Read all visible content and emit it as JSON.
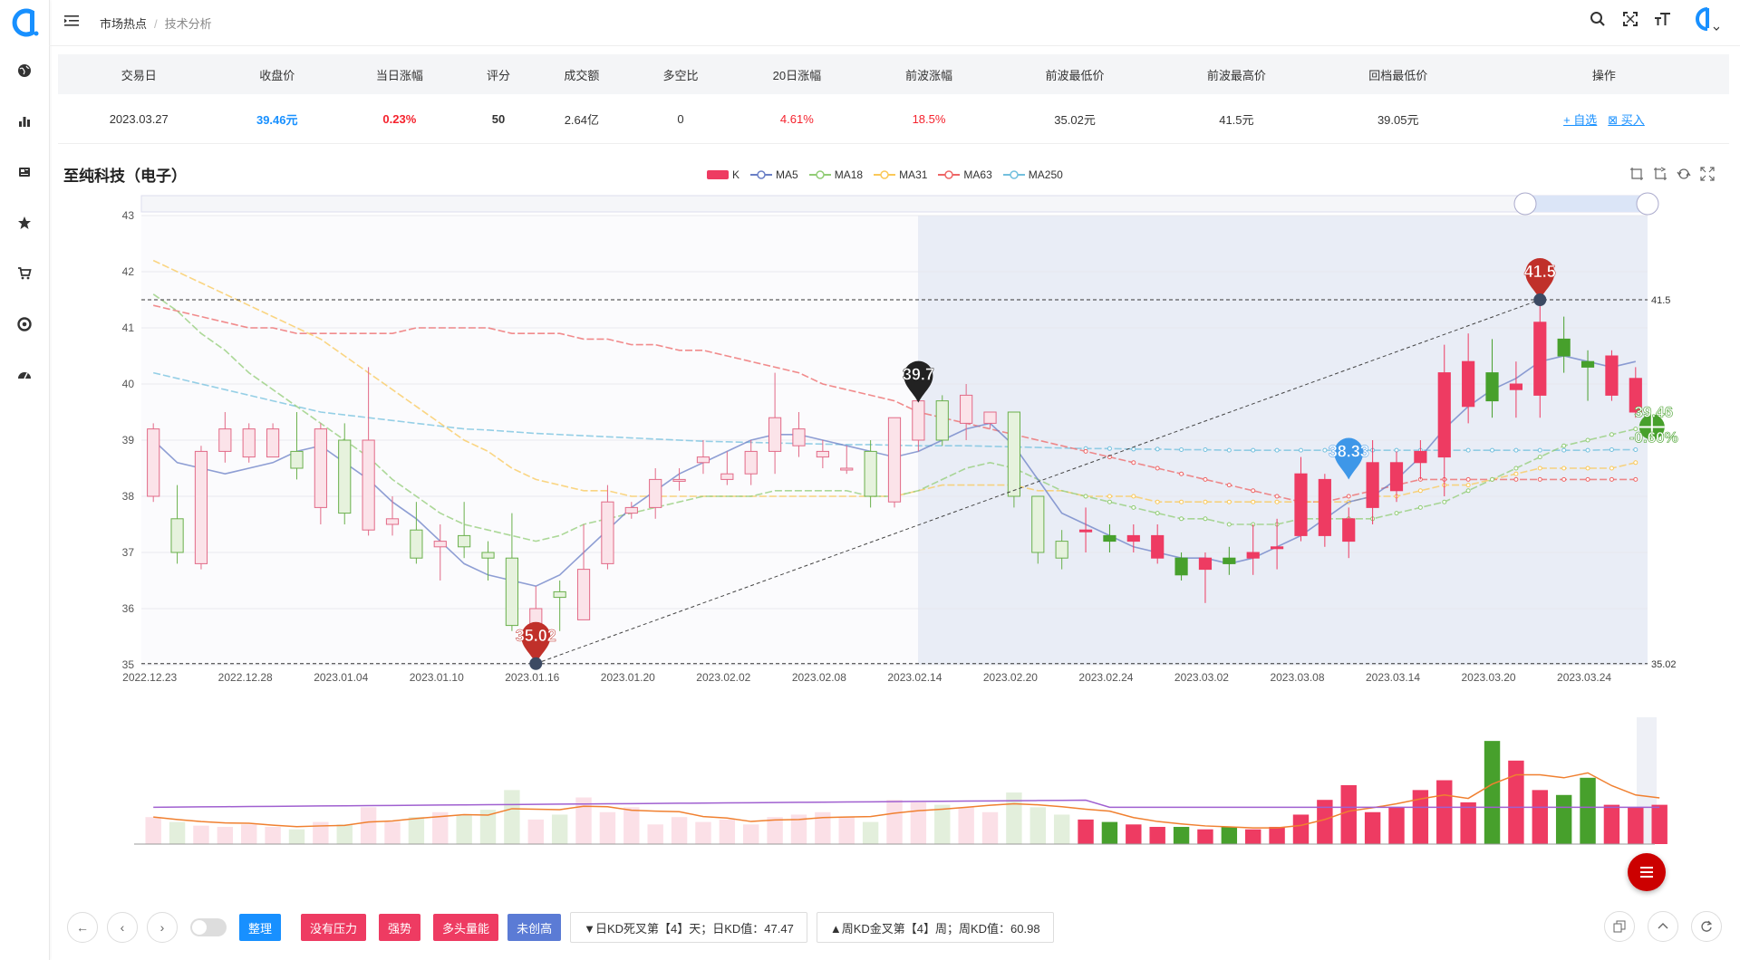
{
  "breadcrumb": {
    "item1": "市场热点",
    "item2": "技术分析"
  },
  "table": {
    "headers": [
      "交易日",
      "收盘价",
      "当日涨幅",
      "评分",
      "成交额",
      "多空比",
      "20日涨幅",
      "前波涨幅",
      "前波最低价",
      "前波最高价",
      "回档最低价",
      "操作"
    ],
    "row": {
      "date": "2023.03.27",
      "close": "39.46元",
      "change": "0.23%",
      "score": "50",
      "amount": "2.64亿",
      "ratio": "0",
      "rise20": "4.61%",
      "prev_rise": "18.5%",
      "prev_low": "35.02元",
      "prev_high": "41.5元",
      "pullback_low": "39.05元"
    },
    "ops": {
      "add": "+ 自选",
      "buy": "买入"
    }
  },
  "stock_title": "至纯科技（电子）",
  "legend": [
    {
      "name": "K",
      "color": "#ee3b62"
    },
    {
      "name": "MA5",
      "color": "#6a7fc6"
    },
    {
      "name": "MA18",
      "color": "#91cc75"
    },
    {
      "name": "MA31",
      "color": "#fac858"
    },
    {
      "name": "MA63",
      "color": "#ee6666"
    },
    {
      "name": "MA250",
      "color": "#73c0de"
    }
  ],
  "chart_data": {
    "type": "candlestick",
    "ylim": [
      35,
      43
    ],
    "yticks": [
      "43",
      "42",
      "41",
      "40",
      "39",
      "38",
      "37",
      "36",
      "35"
    ],
    "xticks": [
      "2022.12.23",
      "2022.12.28",
      "2023.01.04",
      "2023.01.10",
      "2023.01.16",
      "2023.01.20",
      "2023.02.02",
      "2023.02.08",
      "2023.02.14",
      "2023.02.20",
      "2023.02.24",
      "2023.03.02",
      "2023.03.08",
      "2023.03.14",
      "2023.03.20",
      "2023.03.24"
    ],
    "ohlc": [
      [
        38.0,
        39.2,
        37.9,
        39.3
      ],
      [
        37.6,
        37.0,
        36.8,
        38.2
      ],
      [
        36.8,
        38.8,
        36.7,
        38.9
      ],
      [
        38.8,
        39.2,
        38.6,
        39.5
      ],
      [
        38.7,
        39.2,
        38.6,
        39.3
      ],
      [
        38.7,
        39.2,
        38.7,
        39.3
      ],
      [
        38.8,
        38.5,
        38.3,
        39.5
      ],
      [
        37.8,
        39.2,
        37.5,
        39.3
      ],
      [
        39.0,
        37.7,
        37.5,
        39.3
      ],
      [
        37.4,
        39.0,
        37.3,
        40.3
      ],
      [
        37.5,
        37.6,
        37.3,
        38.0
      ],
      [
        37.4,
        36.9,
        36.8,
        37.9
      ],
      [
        37.1,
        37.2,
        36.5,
        37.5
      ],
      [
        37.3,
        37.1,
        36.9,
        37.9
      ],
      [
        37.0,
        36.9,
        36.5,
        37.2
      ],
      [
        36.9,
        35.7,
        35.6,
        37.7
      ],
      [
        35.5,
        36.0,
        35.2,
        36.4
      ],
      [
        36.3,
        36.2,
        35.6,
        36.5
      ],
      [
        35.8,
        36.7,
        35.8,
        37.5
      ],
      [
        36.8,
        37.9,
        36.7,
        38.2
      ],
      [
        37.7,
        37.8,
        37.6,
        37.9
      ],
      [
        37.8,
        38.3,
        37.6,
        38.5
      ],
      [
        38.3,
        38.3,
        38.1,
        38.5
      ],
      [
        38.6,
        38.7,
        38.4,
        39.0
      ],
      [
        38.3,
        38.4,
        38.2,
        38.8
      ],
      [
        38.4,
        38.8,
        38.2,
        39.0
      ],
      [
        38.8,
        39.4,
        38.4,
        40.2
      ],
      [
        38.9,
        39.2,
        38.7,
        39.5
      ],
      [
        38.7,
        38.8,
        38.5,
        39.0
      ],
      [
        38.5,
        38.5,
        38.4,
        38.9
      ],
      [
        38.8,
        38.0,
        37.8,
        39.0
      ],
      [
        37.9,
        39.4,
        37.8,
        39.4
      ],
      [
        39.0,
        39.7,
        38.8,
        39.9
      ],
      [
        39.7,
        39.0,
        38.9,
        39.8
      ],
      [
        39.3,
        39.8,
        39.0,
        40.0
      ],
      [
        39.3,
        39.5,
        39.2,
        39.5
      ],
      [
        39.5,
        38.0,
        37.8,
        39.5
      ],
      [
        38.0,
        37.0,
        36.8,
        38.0
      ],
      [
        37.2,
        36.9,
        36.7,
        37.4
      ],
      [
        37.4,
        37.4,
        37.0,
        37.8
      ],
      [
        37.3,
        37.2,
        37.0,
        37.5
      ],
      [
        37.2,
        37.3,
        37.0,
        37.5
      ],
      [
        36.9,
        37.3,
        36.8,
        37.5
      ],
      [
        36.9,
        36.6,
        36.5,
        37.0
      ],
      [
        36.7,
        36.9,
        36.1,
        37.0
      ],
      [
        36.9,
        36.8,
        36.6,
        37.1
      ],
      [
        36.9,
        37.0,
        36.6,
        37.5
      ],
      [
        37.1,
        37.1,
        36.7,
        37.6
      ],
      [
        37.3,
        38.4,
        37.2,
        38.7
      ],
      [
        37.3,
        38.3,
        37.1,
        38.4
      ],
      [
        37.2,
        37.6,
        36.9,
        37.8
      ],
      [
        37.8,
        38.6,
        37.5,
        39.0
      ],
      [
        38.1,
        38.6,
        37.9,
        38.8
      ],
      [
        38.6,
        38.8,
        38.3,
        39.0
      ],
      [
        38.7,
        40.2,
        38.0,
        40.7
      ],
      [
        39.6,
        40.4,
        39.3,
        40.9
      ],
      [
        40.2,
        39.7,
        39.4,
        40.8
      ],
      [
        39.9,
        40.0,
        39.4,
        40.4
      ],
      [
        39.8,
        41.1,
        39.4,
        41.5
      ],
      [
        40.8,
        40.5,
        40.2,
        41.2
      ],
      [
        40.4,
        40.3,
        39.7,
        40.6
      ],
      [
        39.8,
        40.5,
        39.7,
        40.6
      ],
      [
        39.5,
        40.1,
        39.4,
        40.3
      ]
    ],
    "ma5": [
      39.0,
      38.6,
      38.5,
      38.4,
      38.5,
      38.6,
      38.8,
      38.9,
      38.6,
      38.3,
      37.9,
      37.6,
      37.2,
      36.8,
      36.6,
      36.5,
      36.4,
      36.6,
      37.0,
      37.4,
      37.8,
      38.1,
      38.4,
      38.6,
      38.8,
      39.0,
      39.1,
      39.1,
      39.0,
      38.9,
      38.8,
      38.7,
      38.8,
      39.0,
      39.2,
      39.3,
      38.9,
      38.3,
      37.7,
      37.5,
      37.3,
      37.1,
      37.0,
      36.9,
      36.9,
      36.8,
      36.9,
      37.1,
      37.3,
      37.6,
      37.9,
      38.0,
      38.3,
      38.7,
      39.2,
      39.6,
      39.9,
      40.1,
      40.4,
      40.5,
      40.4,
      40.3,
      40.4
    ],
    "ma18": [
      41.6,
      41.3,
      40.9,
      40.6,
      40.2,
      39.9,
      39.6,
      39.3,
      39.0,
      38.7,
      38.3,
      38.0,
      37.7,
      37.5,
      37.4,
      37.3,
      37.2,
      37.3,
      37.5,
      37.6,
      37.7,
      37.8,
      37.9,
      38.0,
      38.0,
      38.0,
      38.1,
      38.1,
      38.1,
      38.1,
      38.0,
      38.0,
      38.1,
      38.3,
      38.5,
      38.6,
      38.5,
      38.3,
      38.1,
      38.0,
      37.9,
      37.8,
      37.7,
      37.6,
      37.6,
      37.5,
      37.5,
      37.5,
      37.6,
      37.6,
      37.6,
      37.6,
      37.7,
      37.8,
      37.9,
      38.1,
      38.3,
      38.5,
      38.7,
      38.9,
      39.0,
      39.1,
      39.2
    ],
    "ma31": [
      42.2,
      42.0,
      41.8,
      41.6,
      41.4,
      41.2,
      41.0,
      40.8,
      40.5,
      40.2,
      39.9,
      39.6,
      39.3,
      39.0,
      38.8,
      38.5,
      38.3,
      38.2,
      38.1,
      38.1,
      38.0,
      38.0,
      38.0,
      38.0,
      38.0,
      38.0,
      38.0,
      38.0,
      38.0,
      38.0,
      38.0,
      38.0,
      38.1,
      38.2,
      38.2,
      38.2,
      38.2,
      38.1,
      38.1,
      38.0,
      38.0,
      38.0,
      37.9,
      37.9,
      37.9,
      37.9,
      37.9,
      37.9,
      37.9,
      37.9,
      37.9,
      38.0,
      38.0,
      38.1,
      38.2,
      38.2,
      38.3,
      38.4,
      38.5,
      38.5,
      38.5,
      38.5,
      38.6
    ],
    "ma63": [
      41.4,
      41.3,
      41.2,
      41.1,
      41.0,
      41.0,
      40.9,
      40.9,
      40.9,
      40.9,
      40.9,
      41.0,
      41.0,
      41.0,
      41.0,
      40.9,
      40.9,
      40.9,
      40.8,
      40.8,
      40.7,
      40.7,
      40.6,
      40.6,
      40.5,
      40.4,
      40.3,
      40.2,
      40.0,
      39.9,
      39.8,
      39.7,
      39.5,
      39.4,
      39.3,
      39.2,
      39.1,
      39.0,
      38.9,
      38.8,
      38.7,
      38.6,
      38.5,
      38.4,
      38.3,
      38.2,
      38.1,
      38.0,
      37.9,
      37.9,
      38.0,
      38.1,
      38.2,
      38.3,
      38.3,
      38.3,
      38.3,
      38.3,
      38.3,
      38.3,
      38.3,
      38.3,
      38.3
    ],
    "ma250": [
      40.2,
      40.1,
      40.0,
      39.9,
      39.8,
      39.7,
      39.6,
      39.5,
      39.45,
      39.4,
      39.35,
      39.3,
      39.25,
      39.2,
      39.18,
      39.15,
      39.12,
      39.1,
      39.08,
      39.06,
      39.04,
      39.02,
      39.0,
      38.98,
      38.97,
      38.96,
      38.95,
      38.94,
      38.93,
      38.92,
      38.92,
      38.91,
      38.9,
      38.9,
      38.9,
      38.89,
      38.88,
      38.87,
      38.86,
      38.85,
      38.85,
      38.84,
      38.84,
      38.83,
      38.83,
      38.82,
      38.82,
      38.82,
      38.82,
      38.82,
      38.82,
      38.82,
      38.82,
      38.82,
      38.82,
      38.82,
      38.82,
      38.82,
      38.82,
      38.82,
      38.82,
      38.83,
      38.83
    ],
    "markers": [
      {
        "label": "41.5",
        "value": 41.5
      },
      {
        "label": "35.02",
        "value": 35.02
      },
      {
        "label": "39.7",
        "value": 39.7
      },
      {
        "label": "38.33",
        "value": 38.33
      }
    ],
    "hlines": [
      {
        "label": "41.5",
        "value": 41.5
      },
      {
        "label": "35.02",
        "value": 35.02
      }
    ],
    "last_price": "39.46",
    "last_change": "-0.60%",
    "volume": [
      22,
      18,
      15,
      14,
      16,
      14,
      12,
      18,
      16,
      30,
      18,
      22,
      26,
      24,
      28,
      44,
      20,
      24,
      38,
      26,
      30,
      16,
      22,
      18,
      20,
      16,
      22,
      24,
      26,
      22,
      18,
      36,
      34,
      32,
      30,
      26,
      42,
      30,
      24,
      20,
      18,
      16,
      14,
      14,
      12,
      14,
      12,
      14,
      24,
      36,
      48,
      26,
      30,
      44,
      52,
      34,
      84,
      68,
      44,
      40,
      54,
      32,
      30,
      32
    ]
  },
  "bottom": {
    "tags": [
      {
        "label": "整理",
        "color": "#1890ff"
      },
      {
        "label": "没有压力",
        "color": "#ee3b62"
      },
      {
        "label": "强势",
        "color": "#ee3b62"
      },
      {
        "label": "多头量能",
        "color": "#ee3b62"
      },
      {
        "label": "未创高",
        "color": "#5b7bd5"
      }
    ],
    "kd_day": "▼日KD死叉第【4】天；日KD值：47.47",
    "kd_week": "▲周KD金叉第【4】周；周KD值：60.98"
  }
}
